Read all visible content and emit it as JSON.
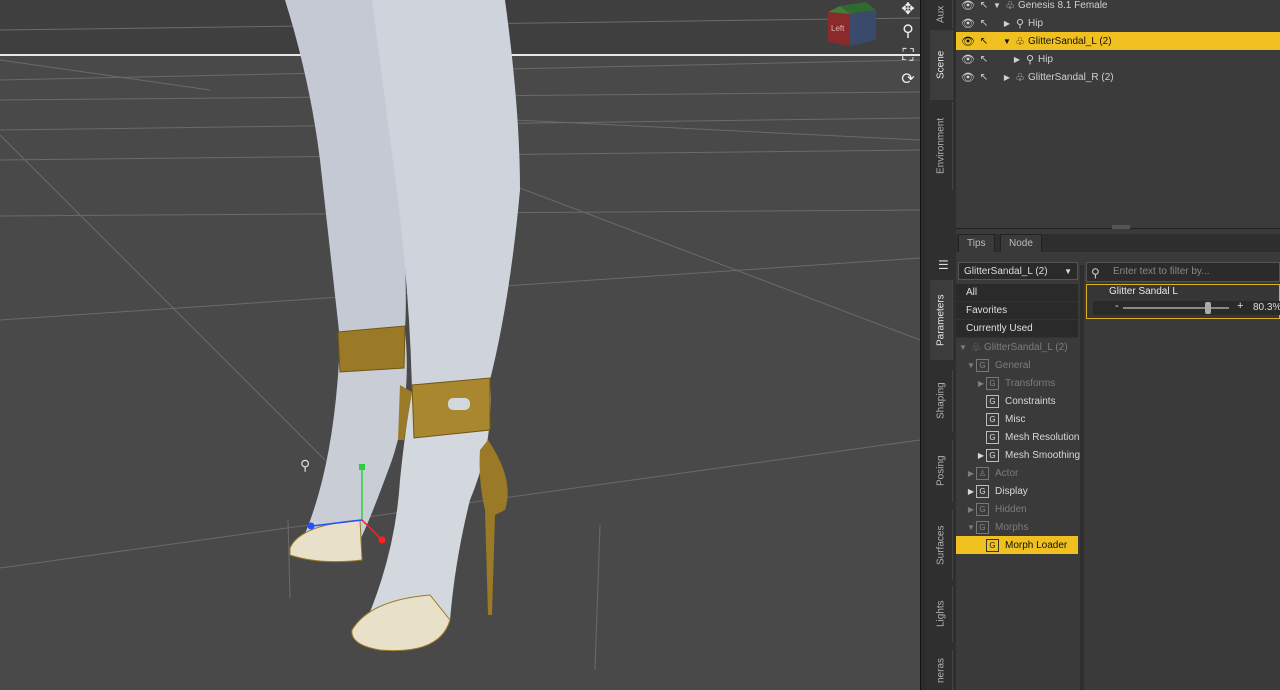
{
  "viewport": {
    "camera_cube_label": "Left",
    "tools": [
      "move-icon",
      "zoom-icon",
      "frame-icon",
      "orbit-icon"
    ]
  },
  "side_tabs": {
    "aux": "Aux",
    "scene": "Scene",
    "environment": "Environment",
    "parameters": "Parameters",
    "shaping": "Shaping",
    "posing": "Posing",
    "surfaces": "Surfaces",
    "lights": "Lights",
    "cameras": "neras"
  },
  "scene": {
    "rows": [
      {
        "label": "Genesis 8.1 Female",
        "selected": false
      },
      {
        "label": "Hip",
        "selected": false
      },
      {
        "label": "GlitterSandal_L (2)",
        "selected": true
      },
      {
        "label": "Hip",
        "selected": false
      },
      {
        "label": "GlitterSandal_R (2)",
        "selected": false
      }
    ]
  },
  "tabs": {
    "tips": "Tips",
    "node": "Node"
  },
  "parameters": {
    "node_selector": "GlitterSandal_L (2)",
    "filter_placeholder": "Enter text to filter by...",
    "groups": {
      "all": "All",
      "favorites": "Favorites",
      "currently_used": "Currently Used"
    },
    "tree": {
      "root": "GlitterSandal_L (2)",
      "general": "General",
      "transforms": "Transforms",
      "constraints": "Constraints",
      "misc": "Misc",
      "mesh_resolution": "Mesh Resolution",
      "mesh_smoothing": "Mesh Smoothing",
      "actor": "Actor",
      "display": "Display",
      "hidden": "Hidden",
      "morphs": "Morphs",
      "morph_loader": "Morph Loader"
    },
    "slider": {
      "label": "Glitter Sandal L",
      "value_text": "80.3%",
      "minus": "-",
      "plus": "+",
      "value": 0.803
    }
  },
  "colors": {
    "selection": "#f0c020",
    "viewport_bg": "#494949"
  }
}
